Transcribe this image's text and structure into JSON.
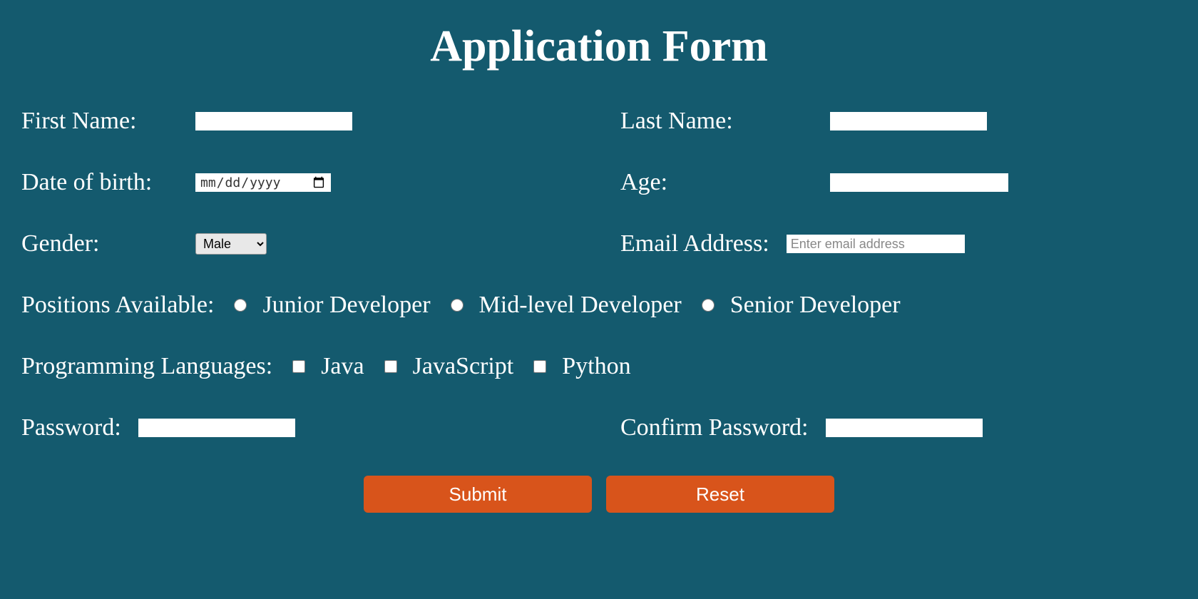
{
  "title": "Application Form",
  "fields": {
    "first_name": {
      "label": "First Name:",
      "value": ""
    },
    "last_name": {
      "label": "Last Name:",
      "value": ""
    },
    "dob": {
      "label": "Date of birth:",
      "placeholder": "mm / dd / yyyy",
      "value": ""
    },
    "age": {
      "label": "Age:",
      "value": ""
    },
    "gender": {
      "label": "Gender:",
      "selected": "Male",
      "options": [
        "Male"
      ]
    },
    "email": {
      "label": "Email Address:",
      "placeholder": "Enter email address",
      "value": ""
    },
    "positions": {
      "label": "Positions Available:",
      "options": [
        "Junior Developer",
        "Mid-level Developer",
        "Senior Developer"
      ]
    },
    "languages": {
      "label": "Programming Languages:",
      "options": [
        "Java",
        "JavaScript",
        "Python"
      ]
    },
    "password": {
      "label": "Password:",
      "value": ""
    },
    "confirm_password": {
      "label": "Confirm Password:",
      "value": ""
    }
  },
  "buttons": {
    "submit": "Submit",
    "reset": "Reset"
  }
}
